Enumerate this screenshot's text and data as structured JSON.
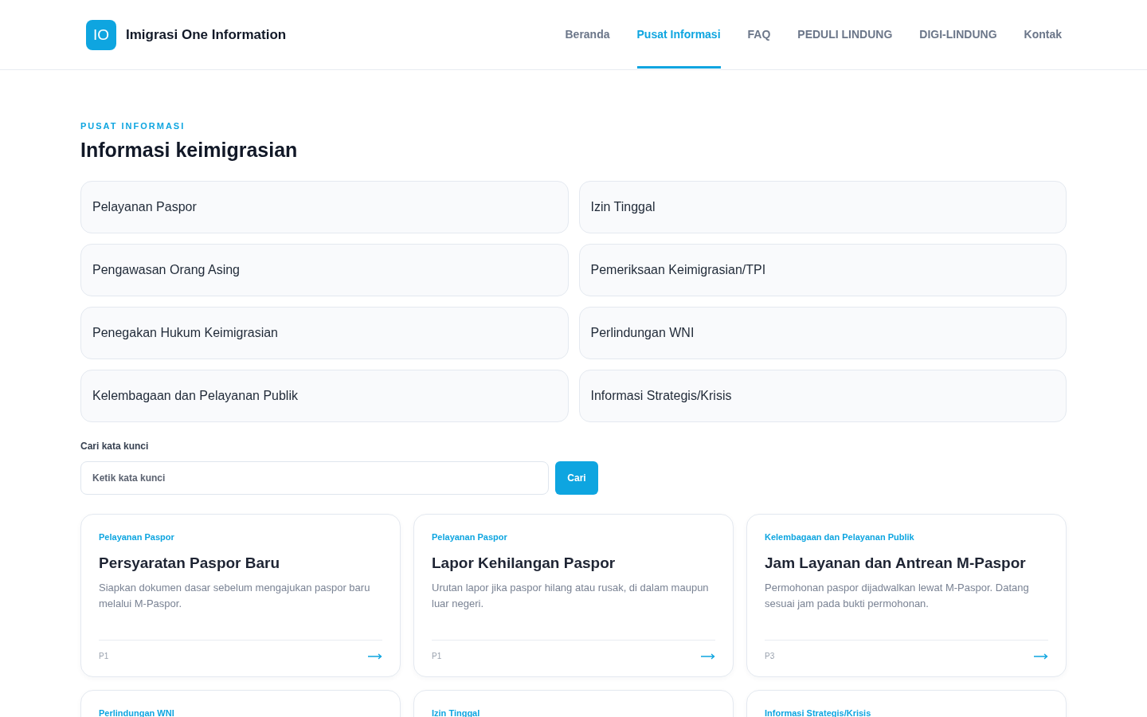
{
  "header": {
    "logo_mark": "IO",
    "brand": "Imigrasi One Information",
    "nav": [
      {
        "label": "Beranda",
        "selected": false
      },
      {
        "label": "Pusat Informasi",
        "selected": true
      },
      {
        "label": "FAQ",
        "selected": false
      },
      {
        "label": "PEDULI LINDUNG",
        "selected": false
      },
      {
        "label": "DIGI-LINDUNG",
        "selected": false
      },
      {
        "label": "Kontak",
        "selected": false
      }
    ]
  },
  "section": {
    "eyebrow": "PUSAT INFORMASI",
    "title": "Informasi keimigrasian"
  },
  "topics": [
    "Pelayanan Paspor",
    "Izin Tinggal",
    "Pengawasan Orang Asing",
    "Pemeriksaan Keimigrasian/TPI",
    "Penegakan Hukum Keimigrasian",
    "Perlindungan WNI",
    "Kelembagaan dan Pelayanan Publik",
    "Informasi Strategis/Krisis"
  ],
  "search": {
    "label": "Cari kata kunci",
    "placeholder": "Ketik kata kunci",
    "button": "Cari"
  },
  "articles": [
    {
      "category": "Pelayanan Paspor",
      "title": "Persyaratan Paspor Baru",
      "summary": "Siapkan dokumen dasar sebelum mengajukan paspor baru melalui M-Paspor.",
      "code": "P1"
    },
    {
      "category": "Pelayanan Paspor",
      "title": "Lapor Kehilangan Paspor",
      "summary": "Urutan lapor jika paspor hilang atau rusak, di dalam maupun luar negeri.",
      "code": "P1"
    },
    {
      "category": "Kelembagaan dan Pelayanan Publik",
      "title": "Jam Layanan dan Antrean M-Paspor",
      "summary": "Permohonan paspor dijadwalkan lewat M-Paspor. Datang sesuai jam pada bukti permohonan.",
      "code": "P3"
    },
    {
      "category": "Perlindungan WNI"
    },
    {
      "category": "Izin Tinggal"
    },
    {
      "category": "Informasi Strategis/Krisis"
    }
  ]
}
